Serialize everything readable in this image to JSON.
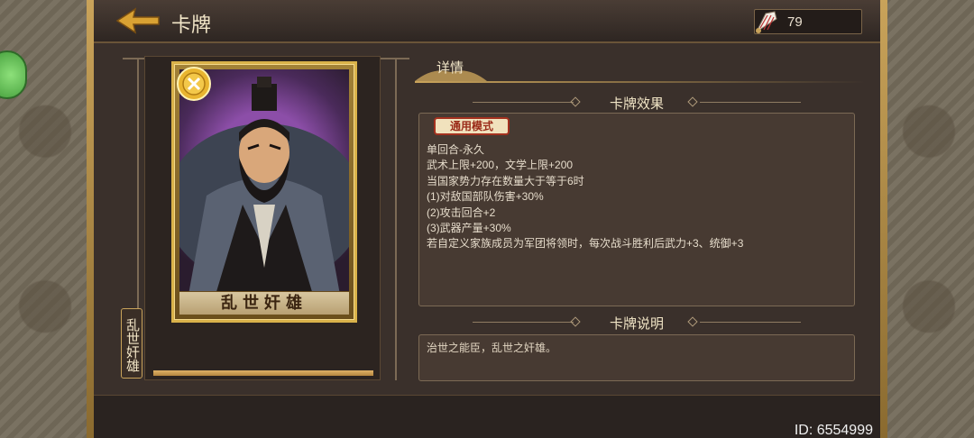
{
  "header": {
    "title": "卡牌",
    "currency": {
      "icon": "feather-fan-icon",
      "value": "79"
    }
  },
  "card": {
    "name_banner": "乱世奸雄",
    "side_label": "乱世奸雄",
    "badge_icon": "gold-medal-icon",
    "progress": 1.0
  },
  "details": {
    "tab_label": "详情",
    "effect": {
      "title": "卡牌效果",
      "mode_tag": "通用模式",
      "lines": [
        "单回合-永久",
        "武术上限+200，文学上限+200",
        "当国家势力存在数量大于等于6时",
        "(1)对敌国部队伤害+30%",
        "(2)攻击回合+2",
        "(3)武器产量+30%",
        "若自定义家族成员为军团将领时，每次战斗胜利后武力+3、统御+3"
      ]
    },
    "description": {
      "title": "卡牌说明",
      "text": "治世之能臣，乱世之奸雄。"
    }
  },
  "footer": {
    "id_text": "ID: 6554999"
  },
  "colors": {
    "accent_gold": "#c9a35a",
    "panel_bg": "#473a32",
    "tag_red": "#a3311f"
  }
}
